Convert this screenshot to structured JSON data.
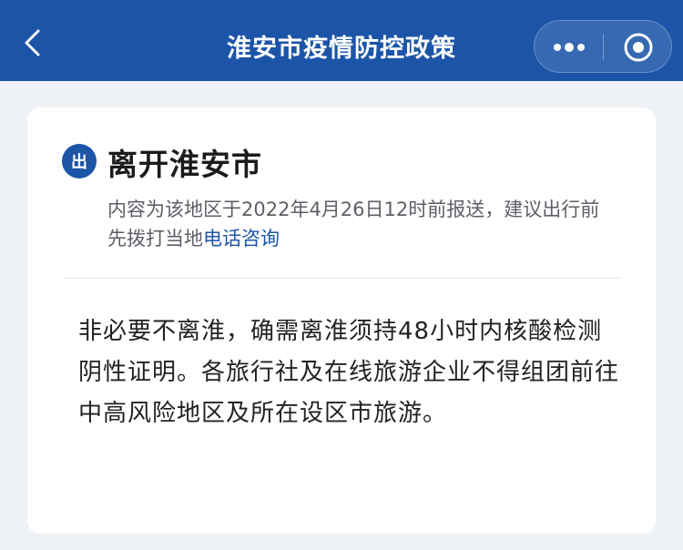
{
  "navbar": {
    "title": "淮安市疫情防控政策",
    "back_icon": "chevron-left-icon",
    "more_icon": "more-dots-icon",
    "close_icon": "target-close-icon",
    "background_color": "#1c55a8"
  },
  "card": {
    "badge": "出",
    "title": "离开淮安市",
    "note_prefix": "内容为该地区于2022年4月26日12时前报送，建议出行前先拨打当地",
    "note_link": "电话咨询",
    "body": "非必要不离淮，确需离淮须持48小时内核酸检测阴性证明。各旅行社及在线旅游企业不得组团前往中高风险地区及所在设区市旅游。"
  }
}
